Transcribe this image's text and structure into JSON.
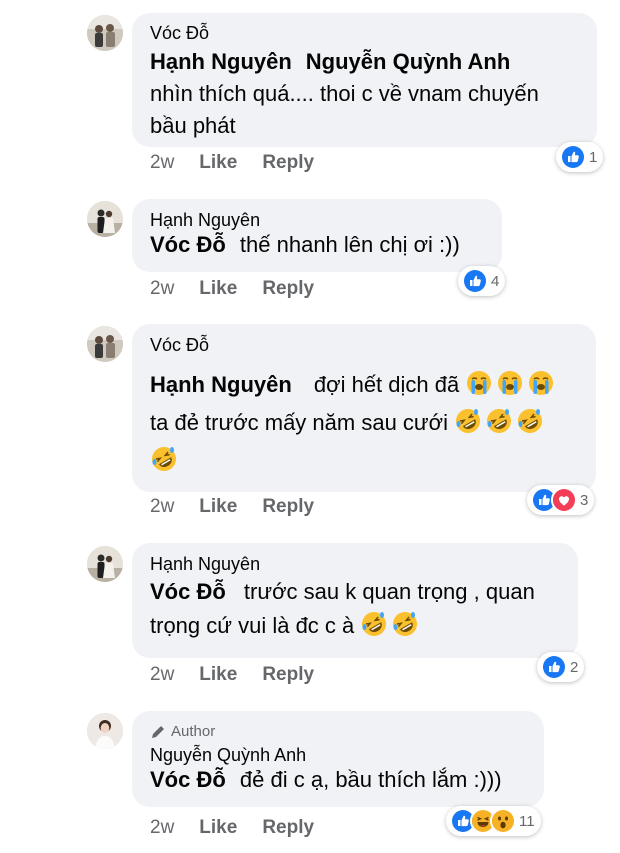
{
  "comments": [
    {
      "name": "Vóc Đỗ",
      "mention": "Hạnh Nguyên",
      "mention2": "Nguyễn Quỳnh Anh",
      "text": "nhìn thích quá.... thoi c về vnam chuyến bầu phát",
      "time": "2w",
      "like": "Like",
      "reply": "Reply",
      "reaction_count": "1"
    },
    {
      "name": "Hạnh Nguyên",
      "mention": "Vóc Đỗ",
      "text": "thế nhanh lên chị ơi :))",
      "time": "2w",
      "like": "Like",
      "reply": "Reply",
      "reaction_count": "4"
    },
    {
      "name": "Vóc Đỗ",
      "mention": "Hạnh Nguyên",
      "text_line1": "đợi hết dịch đã",
      "text_line2": "ta đẻ trước mấy năm sau cưới",
      "time": "2w",
      "like": "Like",
      "reply": "Reply",
      "reaction_count": "3"
    },
    {
      "name": "Hạnh Nguyên",
      "mention": "Vóc Đỗ",
      "text_line1": "trước sau k quan trọng , quan",
      "text_line2": "trọng cứ vui là đc c à",
      "time": "2w",
      "like": "Like",
      "reply": "Reply",
      "reaction_count": "2"
    },
    {
      "author_badge": "Author",
      "name": "Nguyễn Quỳnh Anh",
      "mention": "Vóc Đỗ",
      "text": "đẻ đi c ạ, bầu thích lắm :)))",
      "time": "2w",
      "like": "Like",
      "reply": "Reply",
      "reaction_count": "11"
    }
  ],
  "colors": {
    "like_blue": "#1877f2",
    "love_red": "#f33e58",
    "haha_yellow": "#f7b125",
    "bubble": "#f0f2f5",
    "meta": "#65676b"
  },
  "icons": [
    "thumbs-up-icon",
    "heart-icon",
    "laughing-crying-emoji",
    "loudly-crying-emoji",
    "rolling-laughing-emoji",
    "wow-emoji",
    "pencil-icon"
  ]
}
